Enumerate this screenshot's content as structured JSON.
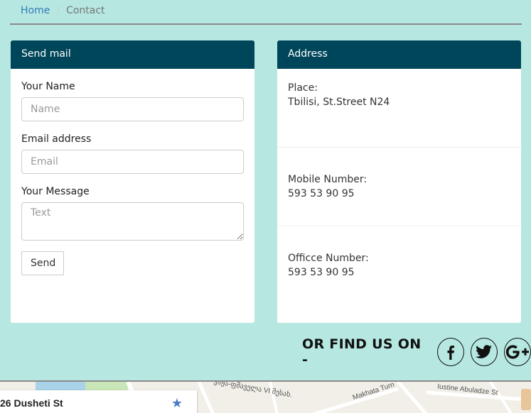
{
  "breadcrumb": {
    "home": "Home",
    "separator": "/",
    "current": "Contact"
  },
  "send_mail": {
    "heading": "Send mail",
    "name_label": "Your Name",
    "name_placeholder": "Name",
    "email_label": "Email address",
    "email_placeholder": "Email",
    "message_label": "Your Message",
    "message_placeholder": "Text",
    "send_label": "Send"
  },
  "address": {
    "heading": "Address",
    "place_label": "Place:",
    "place_value": "Tbilisi, St.Street N24",
    "mobile_label": "Mobile Number:",
    "mobile_value": "593 53 90 95",
    "office_label": "Officce Number:",
    "office_value": "593 53 90 95"
  },
  "find_us": {
    "text": "OR FIND US ON -",
    "icons": [
      "facebook-icon",
      "twitter-icon",
      "google-plus-icon"
    ]
  },
  "map": {
    "place_title": "26 Dusheti St",
    "streets": [
      "Makhata Turn",
      "Iustine Abuladze St",
      "ვაჟა-ფშაველა VI შესახ."
    ]
  },
  "colors": {
    "background": "#b6e8e1",
    "panel_heading": "#00465a",
    "link": "#337ab7"
  }
}
